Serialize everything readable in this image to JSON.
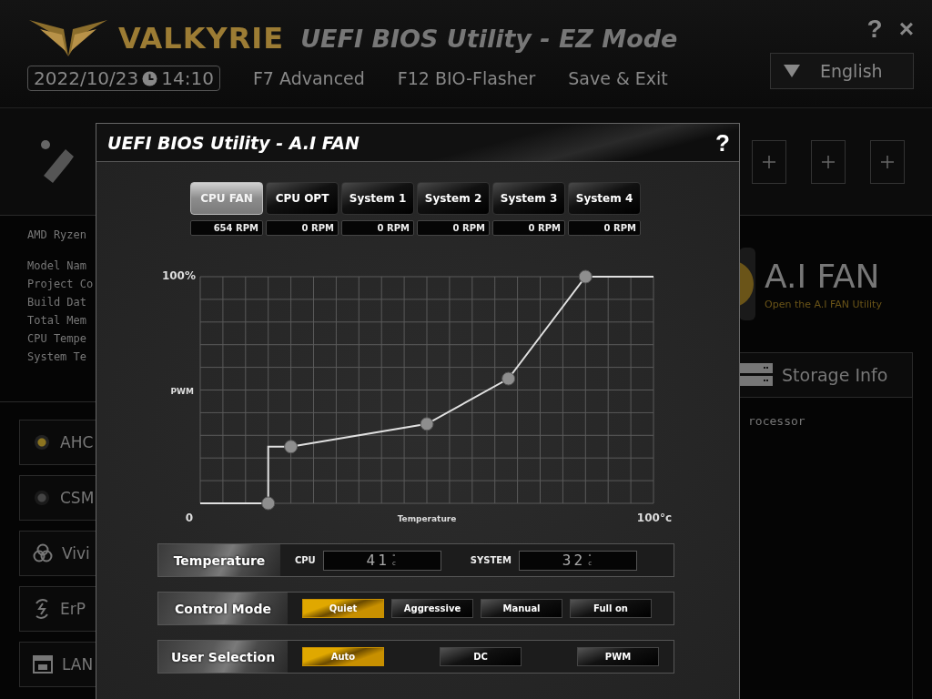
{
  "header": {
    "logo": "VALKYRIE",
    "title": "UEFI BIOS Utility - EZ Mode",
    "date": "2022/10/23",
    "time": "14:10",
    "menu": [
      "F7 Advanced",
      "F12 BIO-Flasher",
      "Save & Exit"
    ],
    "help": "?",
    "close": "×",
    "language": "English"
  },
  "system_info": {
    "cpu": "AMD Ryzen",
    "lines": [
      "Model Nam",
      "Project Co",
      "Build Dat",
      "Total Mem",
      "CPU Tempe",
      "System Te"
    ]
  },
  "toggles": [
    {
      "label": "AHC",
      "kind": "radio",
      "on": true
    },
    {
      "label": "CSM",
      "kind": "radio",
      "on": false
    },
    {
      "label": "Vivi",
      "kind": "rgb"
    },
    {
      "label": "ErP",
      "kind": "power"
    },
    {
      "label": "LAN",
      "kind": "network"
    }
  ],
  "ai_fan_card": {
    "title": "A.I FAN",
    "subtitle": "Open the A.I FAN Utility"
  },
  "storage": {
    "title": "Storage Info",
    "lines": [
      "rocessor"
    ]
  },
  "dialog": {
    "title": "UEFI BIOS Utility - A.I FAN",
    "help": "?",
    "fans": [
      {
        "label": "CPU FAN",
        "rpm": "654 RPM",
        "selected": true
      },
      {
        "label": "CPU OPT",
        "rpm": "0 RPM",
        "selected": false
      },
      {
        "label": "System 1",
        "rpm": "0 RPM",
        "selected": false
      },
      {
        "label": "System 2",
        "rpm": "0 RPM",
        "selected": false
      },
      {
        "label": "System 3",
        "rpm": "0 RPM",
        "selected": false
      },
      {
        "label": "System 4",
        "rpm": "0 RPM",
        "selected": false
      }
    ],
    "fan_curve": {
      "y_max": "100%",
      "y_label": "PWM",
      "x_min": "0",
      "x_label": "Temperature",
      "x_max": "100°c"
    },
    "temperature": {
      "label": "Temperature",
      "readings": [
        {
          "label": "CPU",
          "value": "41",
          "unit": "°c"
        },
        {
          "label": "SYSTEM",
          "value": "32",
          "unit": "°c"
        }
      ]
    },
    "control_mode": {
      "label": "Control Mode",
      "options": [
        {
          "label": "Quiet",
          "selected": true
        },
        {
          "label": "Aggressive",
          "selected": false
        },
        {
          "label": "Manual",
          "selected": false
        },
        {
          "label": "Full on",
          "selected": false
        }
      ]
    },
    "user_selection": {
      "label": "User Selection",
      "options": [
        {
          "label": "Auto",
          "selected": true
        },
        {
          "label": "DC",
          "selected": false
        },
        {
          "label": "PWM",
          "selected": false
        }
      ]
    }
  }
}
